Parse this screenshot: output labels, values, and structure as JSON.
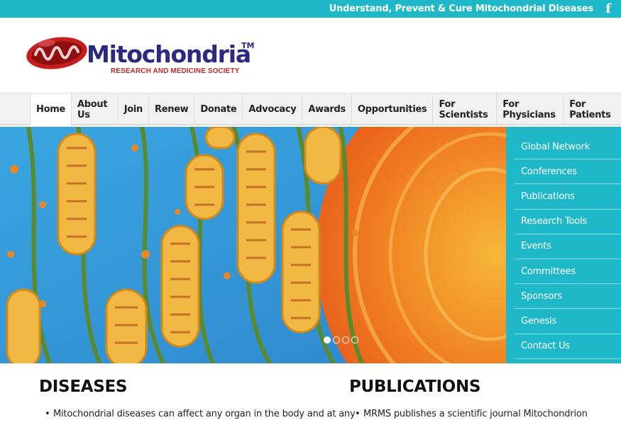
{
  "topbar": {
    "tagline": "Understand, Prevent & Cure Mitochondrial Diseases",
    "facebook_icon": "f"
  },
  "logo": {
    "brand": "Mitochondria",
    "trademark": "TM",
    "subtitle": "RESEARCH AND MEDICINE SOCIETY"
  },
  "nav": {
    "items": [
      "Home",
      "About Us",
      "Join",
      "Renew",
      "Donate",
      "Advocacy",
      "Awards",
      "Opportunities",
      "For Scientists",
      "For Physicians",
      "For Patients"
    ],
    "active": "Home"
  },
  "slider": {
    "slide_count": 4,
    "active_index": 0
  },
  "side_menu": {
    "items": [
      "Global Network",
      "Conferences",
      "Publications",
      "Research Tools",
      "Events",
      "Committees",
      "Sponsors",
      "Genesis",
      "Contact Us"
    ]
  },
  "sections": {
    "diseases": {
      "title": "DISEASES",
      "bullet": "Mitochondrial diseases can affect any organ in the body and at any"
    },
    "publications": {
      "title": "PUBLICATIONS",
      "bullet": "MRMS publishes a scientific journal Mitochondrion"
    }
  },
  "colors": {
    "accent": "#1fb8c8",
    "brand_navy": "#2b2a80",
    "brand_red": "#c62828"
  }
}
